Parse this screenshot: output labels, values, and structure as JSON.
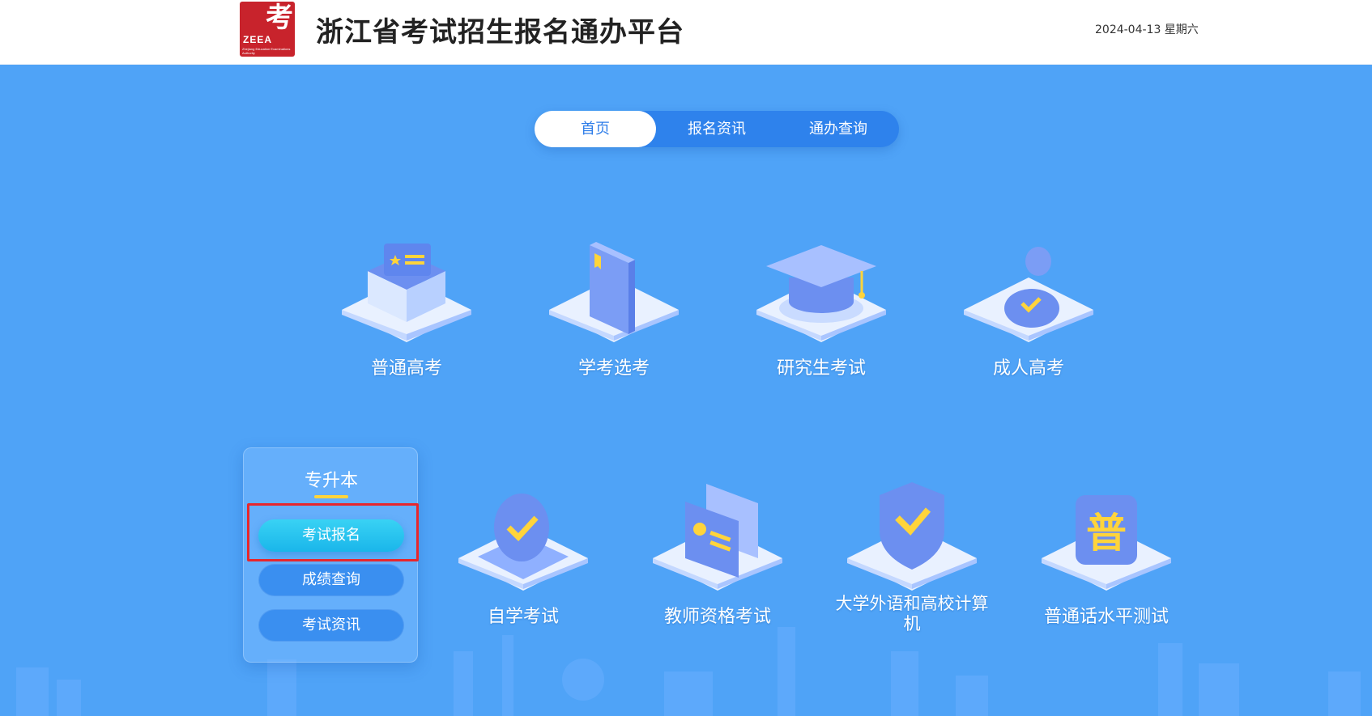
{
  "header": {
    "logo": {
      "glyph": "考",
      "abbr": "ZEEA",
      "sub": "Zhejiang Education Examinations Authority"
    },
    "title": "浙江省考试招生报名通办平台",
    "date": "2024-04-13 星期六"
  },
  "nav": {
    "tabs": [
      {
        "label": "首页",
        "active": true
      },
      {
        "label": "报名资讯",
        "active": false
      },
      {
        "label": "通办查询",
        "active": false
      }
    ]
  },
  "services": {
    "row1": [
      {
        "label": "普通高考",
        "icon": "exam-box-icon"
      },
      {
        "label": "学考选考",
        "icon": "book-icon"
      },
      {
        "label": "研究生考试",
        "icon": "graduation-cap-icon"
      },
      {
        "label": "成人高考",
        "icon": "person-check-icon"
      }
    ],
    "row2": [
      {
        "label": "自学考试",
        "icon": "checkmark-badge-icon"
      },
      {
        "label": "教师资格考试",
        "icon": "id-card-icon"
      },
      {
        "label": "大学外语和高校计算机",
        "icon": "shield-check-icon"
      },
      {
        "label": "普通话水平测试",
        "icon": "pu-character-icon"
      }
    ]
  },
  "panel": {
    "title": "专升本",
    "buttons": [
      "考试报名",
      "成绩查询",
      "考试资讯"
    ]
  },
  "colors": {
    "background": "#4fa3f7",
    "nav_bg": "#2e82ec",
    "highlight": "#e8262c",
    "accent_yellow": "#ffd43b",
    "logo_red": "#c8232c"
  }
}
